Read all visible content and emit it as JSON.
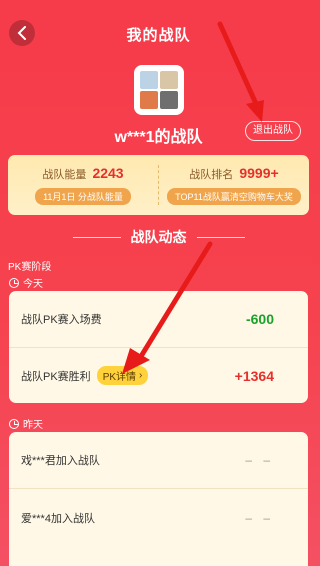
{
  "header": {
    "title": "我的战队"
  },
  "team": {
    "name": "w***1的战队",
    "exit_label": "退出战队"
  },
  "stats": {
    "energy_label": "战队能量",
    "energy_value": "2243",
    "energy_sub": "11月1日 分战队能量",
    "rank_label": "战队排名",
    "rank_value": "9999+",
    "rank_sub": "TOP11战队赢清空购物车大奖"
  },
  "section": {
    "title": "战队动态",
    "stage": "PK赛阶段"
  },
  "today": {
    "label": "今天",
    "rows": [
      {
        "label": "战队PK赛入场费",
        "value": "-600"
      },
      {
        "label": "战队PK赛胜利",
        "tag": "PK详情",
        "value": "+1364"
      }
    ]
  },
  "yesterday": {
    "label": "昨天",
    "rows": [
      {
        "label": "戏***君加入战队",
        "value": "– –"
      },
      {
        "label": "爱***4加入战队",
        "value": "– –"
      }
    ]
  },
  "colors": {
    "accent": "#f63b4a",
    "energy": "#e5302d",
    "negative": "#1aa12a",
    "tag": "#ffd23c"
  }
}
